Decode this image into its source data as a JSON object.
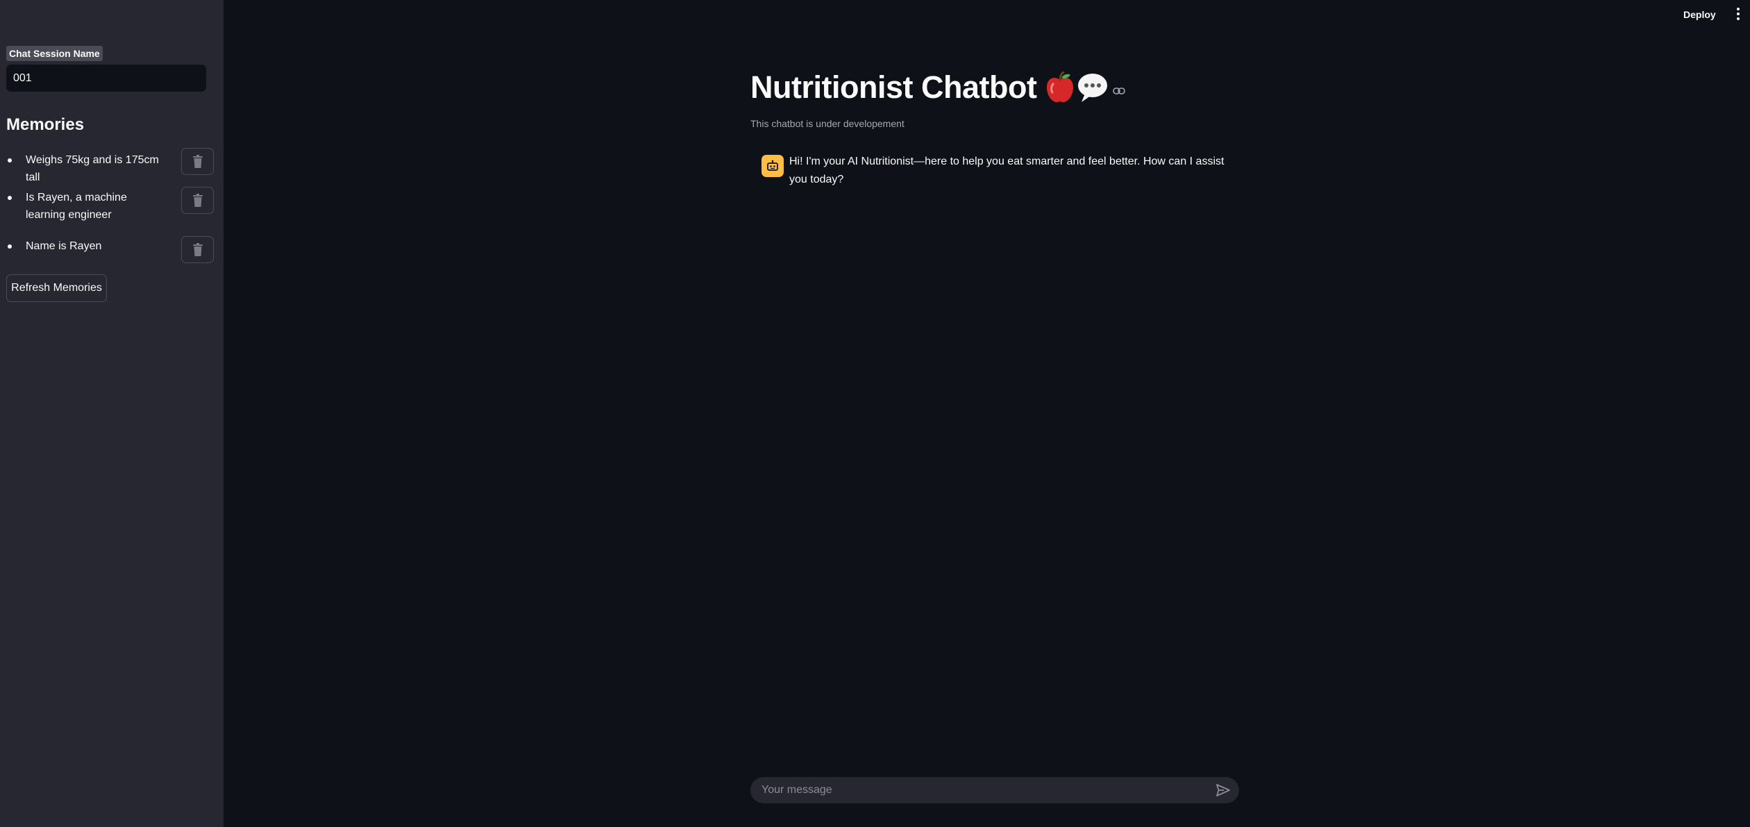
{
  "sidebar": {
    "session_label": "Chat Session Name",
    "session_value": "001",
    "memories_heading": "Memories",
    "memories": [
      {
        "text": "Weighs 75kg and is 175cm tall"
      },
      {
        "text": "Is Rayen, a machine learning engineer"
      },
      {
        "text": "Name is Rayen"
      }
    ],
    "refresh_label": "Refresh Memories"
  },
  "header": {
    "deploy_label": "Deploy",
    "menu_icon": "more-vertical-icon"
  },
  "main": {
    "title": "Nutritionist Chatbot",
    "title_emojis": [
      "apple",
      "speech-bubble"
    ],
    "subtitle": "This chatbot is under developement",
    "messages": [
      {
        "role": "assistant",
        "avatar_icon": "robot-icon",
        "text": "Hi! I'm your AI Nutritionist—here to help you eat smarter and feel better. How can I assist you today?"
      }
    ]
  },
  "chat_input": {
    "placeholder": "Your message",
    "send_icon": "send-icon"
  },
  "colors": {
    "background": "#0e1117",
    "sidebar": "#262730",
    "avatar": "#ffbd45",
    "text": "#fafafa",
    "muted_text": "#a3a8b4"
  }
}
